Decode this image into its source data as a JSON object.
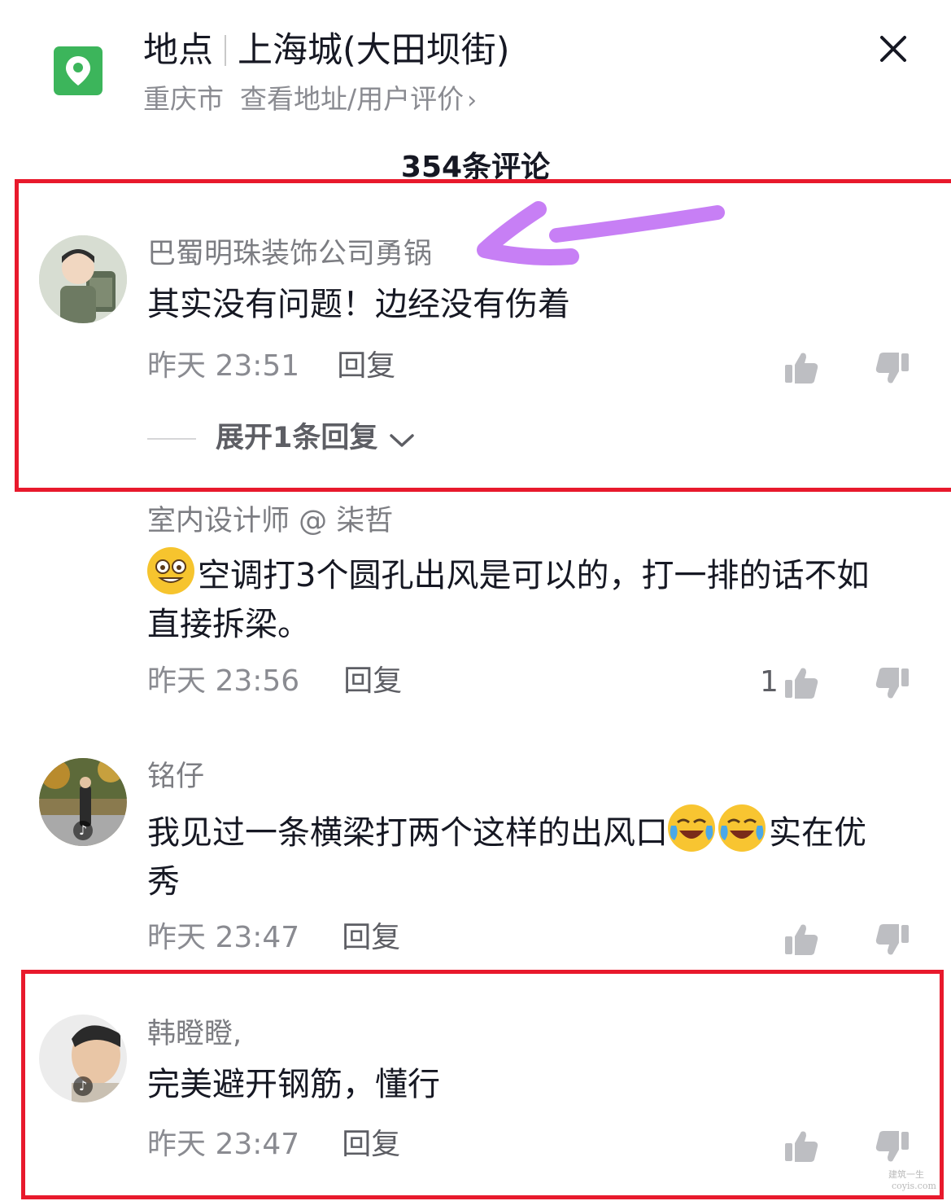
{
  "header": {
    "label": "地点",
    "place": "上海城(大田坝街)",
    "city": "重庆市",
    "link": "查看地址/用户评价",
    "link_chevron": "›",
    "close_icon": "close-icon",
    "pin_icon": "location-pin-icon",
    "pin_color": "#3cb55b"
  },
  "comment_count_label": "354条评论",
  "comments": [
    {
      "user": "巴蜀明珠装饰公司勇锅",
      "text": "其实没有问题！边经没有伤着",
      "time": "昨天 23:51",
      "reply": "回复",
      "likes": "",
      "expand": "展开1条回复",
      "highlighted": true
    },
    {
      "user": "室内设计师 @ 柒哲",
      "text": "空调打3个圆孔出风是可以的，打一排的话不如直接拆梁。",
      "time": "昨天 23:56",
      "reply": "回复",
      "likes": "1",
      "highlighted": false
    },
    {
      "user": "铭仔",
      "text_a": "我见过一条横梁打两个这样的出风口",
      "text_b": "实在优秀",
      "time": "昨天 23:47",
      "reply": "回复",
      "likes": "",
      "highlighted": false
    },
    {
      "user": "韩瞪瞪,",
      "text": "完美避开钢筋，懂行",
      "time": "昨天 23:47",
      "reply": "回复",
      "likes": "",
      "highlighted": true
    }
  ],
  "colors": {
    "highlight_box": "#e8192c",
    "annotation_arrow": "#c77ff5"
  },
  "watermark": {
    "line1": "建筑一生",
    "line2": "coyis.com"
  }
}
